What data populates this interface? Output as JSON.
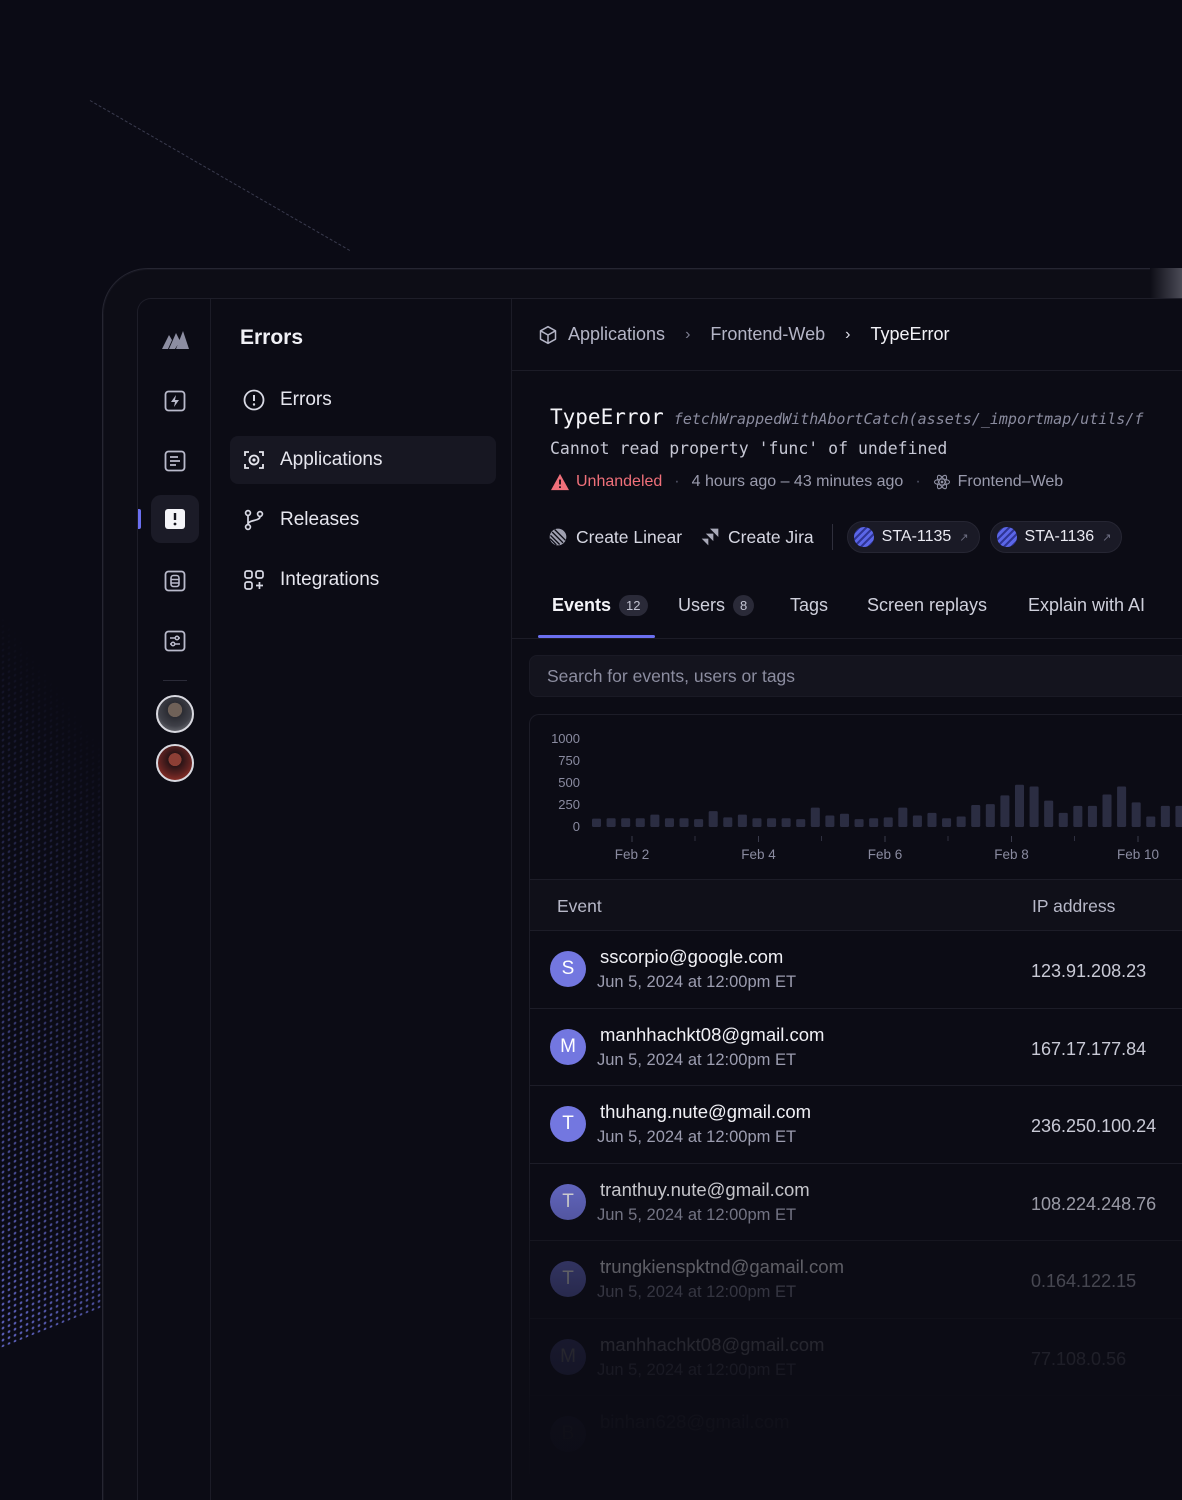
{
  "sidebar": {
    "title": "Errors",
    "items": [
      {
        "label": "Errors",
        "icon": "alert-circle-icon"
      },
      {
        "label": "Applications",
        "icon": "application-scan-icon",
        "active": true
      },
      {
        "label": "Releases",
        "icon": "git-branch-icon"
      },
      {
        "label": "Integrations",
        "icon": "grid-plus-icon"
      }
    ]
  },
  "rail": {
    "icons": [
      "logo-icon",
      "bolt-icon",
      "list-icon",
      "alert-square-icon",
      "database-icon",
      "sliders-icon"
    ],
    "active": "alert-square-icon"
  },
  "breadcrumb": {
    "items": [
      "Applications",
      "Frontend-Web",
      "TypeError"
    ]
  },
  "error": {
    "type": "TypeError",
    "location": "fetchWrappedWithAbortCatch(assets/_importmap/utils/f",
    "message": "Cannot read property 'func' of undefined",
    "status": "Unhandeled",
    "time_range": "4 hours ago – 43 minutes ago",
    "app": "Frontend–Web"
  },
  "actions": {
    "create_linear": "Create Linear",
    "create_jira": "Create Jira",
    "issues": [
      "STA-1135",
      "STA-1136"
    ]
  },
  "tabs": [
    {
      "label": "Events",
      "count": "12",
      "active": true
    },
    {
      "label": "Users",
      "count": "8"
    },
    {
      "label": "Tags"
    },
    {
      "label": "Screen replays"
    },
    {
      "label": "Explain with AI"
    }
  ],
  "search": {
    "placeholder": "Search for events, users or tags"
  },
  "chart_data": {
    "type": "bar",
    "ylim": [
      0,
      1000
    ],
    "y_ticks": [
      "1000",
      "750",
      "500",
      "250",
      "0"
    ],
    "x_ticks": [
      "Feb 2",
      "Feb 4",
      "Feb 6",
      "Feb 8",
      "Feb 10"
    ],
    "values": [
      95,
      100,
      100,
      100,
      140,
      100,
      100,
      90,
      180,
      110,
      140,
      100,
      100,
      100,
      90,
      220,
      130,
      150,
      90,
      100,
      110,
      220,
      130,
      160,
      100,
      120,
      250,
      260,
      360,
      480,
      460,
      300,
      160,
      240,
      240,
      370,
      460,
      280,
      120,
      240,
      240
    ]
  },
  "table": {
    "columns": [
      "Event",
      "IP address"
    ],
    "rows": [
      {
        "initial": "S",
        "email": "sscorpio@google.com",
        "date": "Jun 5, 2024 at 12:00pm ET",
        "ip": "123.91.208.23"
      },
      {
        "initial": "M",
        "email": "manhhachkt08@gmail.com",
        "date": "Jun 5, 2024 at 12:00pm ET",
        "ip": "167.17.177.84"
      },
      {
        "initial": "T",
        "email": "thuhang.nute@gmail.com",
        "date": "Jun 5, 2024 at 12:00pm ET",
        "ip": "236.250.100.24"
      },
      {
        "initial": "T",
        "email": "tranthuy.nute@gmail.com",
        "date": "Jun 5, 2024 at 12:00pm ET",
        "ip": "108.224.248.76"
      },
      {
        "initial": "T",
        "email": "trungkienspktnd@gamail.com",
        "date": "Jun 5, 2024 at 12:00pm ET",
        "ip": "0.164.122.15"
      },
      {
        "initial": "M",
        "email": "manhhachkt08@gmail.com",
        "date": "Jun 5, 2024 at 12:00pm ET",
        "ip": "77.108.0.56"
      },
      {
        "initial": "B",
        "email": "binhan628@gmail.com",
        "date": "",
        "ip": ""
      }
    ]
  },
  "colors": {
    "accent": "#6b6ff0",
    "danger": "#f0707a",
    "avatar": "#7377e0"
  }
}
